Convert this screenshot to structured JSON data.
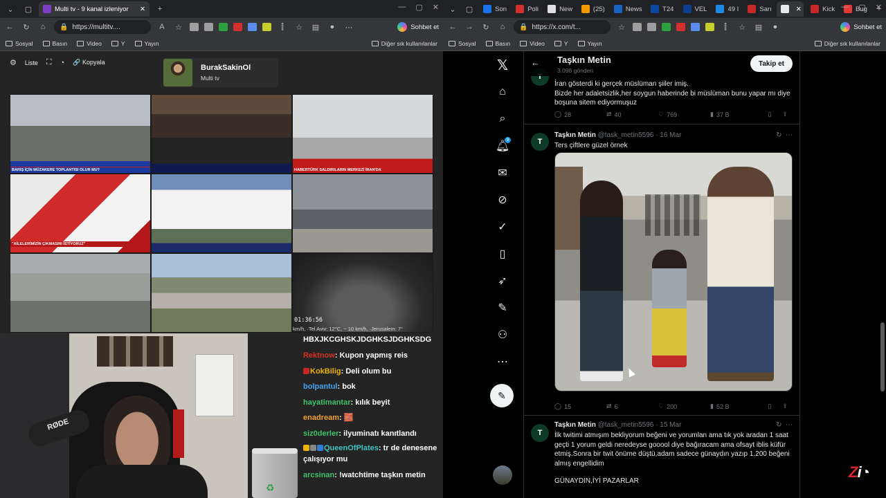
{
  "left_browser": {
    "tabs": [
      {
        "label": "Multi tv - 9 kanal izleniyor",
        "active": true,
        "color": "#7b3fc4"
      }
    ],
    "url": "https://multitv....",
    "chat_button": "Sohbet et",
    "bookmarks": [
      "Sosyal",
      "Basın",
      "Video",
      "Y",
      "Yayın"
    ],
    "bookmarks_right": "Diğer sık kullanılanlar"
  },
  "right_browser": {
    "tabs": [
      {
        "label": "Son",
        "color": "#1a73e8"
      },
      {
        "label": "Poli",
        "color": "#d32f2f"
      },
      {
        "label": "New",
        "color": "#e0e0e0"
      },
      {
        "label": "(25)",
        "color": "#f29900"
      },
      {
        "label": "News",
        "color": "#1565c0"
      },
      {
        "label": "T24",
        "color": "#0d47a1"
      },
      {
        "label": "VEL",
        "color": "#0b3d91"
      },
      {
        "label": "49 I",
        "color": "#1e88e5"
      },
      {
        "label": "Sarı",
        "color": "#c62828"
      },
      {
        "label": "",
        "color": "#e7e9ea",
        "active": true
      },
      {
        "label": "Kick",
        "color": "#c62828"
      },
      {
        "label": "Bug",
        "color": "#e53935"
      }
    ],
    "url": "https://x.com/t...",
    "chat_button": "Sohbet et",
    "bookmarks": [
      "Sosyal",
      "Basın",
      "Video",
      "Y",
      "Yayın"
    ],
    "bookmarks_right": "Diğer sık kullanılanlar"
  },
  "multitv": {
    "toolbar": {
      "list_label": "Liste",
      "copy_label": "Kopyala"
    },
    "user": {
      "name": "BurakSakinOl",
      "subtitle": "Multi tv"
    },
    "channels": [
      {
        "banner": "BARIŞ İÇİN MÜZAKERE TOPLANTISI OLUR MU?",
        "banner_color": "#1d3aa0"
      },
      {
        "banner": "",
        "banner_color": "#0f1a50"
      },
      {
        "banner": "HABERTÜRK SALDIRILARIN MERKEZİ İRAN'DA",
        "banner_color": "#c21b1b"
      },
      {
        "banner": "\"AİLELERİMİZİN ÇIKMASINI İSTİYORUZ\"",
        "banner_color": "#b3171a"
      },
      {
        "banner": "",
        "banner_color": "#1b2b6a"
      },
      {
        "banner": "",
        "banner_color": ""
      },
      {
        "banner": "",
        "banner_color": ""
      },
      {
        "banner": "",
        "banner_color": ""
      },
      {
        "banner": "",
        "banner_color": ""
      }
    ],
    "clock_overlay": "01:36:56",
    "weather_ticker": "km/h, ·Tel Aviv: 12°C, ~ 10 km/h, ·Jerusalem: 7°"
  },
  "chat": {
    "first_line": "HBXJKCGHSKJDGHKSJDGHKSDG",
    "messages": [
      {
        "user": "Rektnow",
        "user_color": "#d93025",
        "text": "Kupon yapmış reis",
        "badges": []
      },
      {
        "user": "KokBilig",
        "user_color": "#e8b400",
        "text": "Deli olum bu",
        "badges": [
          "#c62828"
        ]
      },
      {
        "user": "bolpantul",
        "user_color": "#4aa3f0",
        "text": "bok",
        "badges": []
      },
      {
        "user": "hayatimantar",
        "user_color": "#3ec36b",
        "text": "kılık beyit",
        "badges": []
      },
      {
        "user": "enadream",
        "user_color": "#f0a030",
        "text": "🧱",
        "badges": []
      },
      {
        "user": "siz0derler",
        "user_color": "#3ec36b",
        "text": "ilyuminatı kanıtlandı",
        "badges": []
      },
      {
        "user": "QueenOfPlates",
        "user_color": "#3ec3c3",
        "text": "tr de denesene çalışıyor mu",
        "badges": [
          "#e8b400",
          "#888888",
          "#2f7fd6"
        ]
      },
      {
        "user": "arcsinan",
        "user_color": "#3ec36b",
        "text": "!watchtime taşkın metin",
        "badges": []
      }
    ]
  },
  "x": {
    "header": {
      "name": "Taşkın Metin",
      "post_count": "3.098 gönderi",
      "follow_label": "Takip et"
    },
    "tweets": [
      {
        "text": "İran gösterdi ki gerçek müslüman şiiler imiş.\nBizde her adaletsizlik,her soygun haberinde bi müslüman bunu yapar mı diye boşuna sitem ediyormuşuz",
        "replies": "28",
        "retweets": "40",
        "likes": "769",
        "views": "37 B"
      },
      {
        "name": "Taşkın Metin",
        "handle": "@task_metin5596",
        "date": "16 Mar",
        "text": "Ters çiftlere güzel örnek",
        "replies": "15",
        "retweets": "6",
        "likes": "200",
        "views": "52 B"
      },
      {
        "name": "Taşkın Metin",
        "handle": "@task_metin5596",
        "date": "15 Mar",
        "text": "İlk twitimi atmışım bekliyorum beğeni ve yorumlan ama tık yok aradan 1 saat geçti 1 yorum geldi neredeyse gooool diye bağıracam ama ofsayt iblis küfür etmiş.Sonra bir twit önüme düştü,adam sadece günaydın yazıp 1.200 beğeni almış engellidim",
        "text2": "GÜNAYDIN,İYİ PAZARLAR"
      }
    ]
  },
  "watermark": "Z"
}
